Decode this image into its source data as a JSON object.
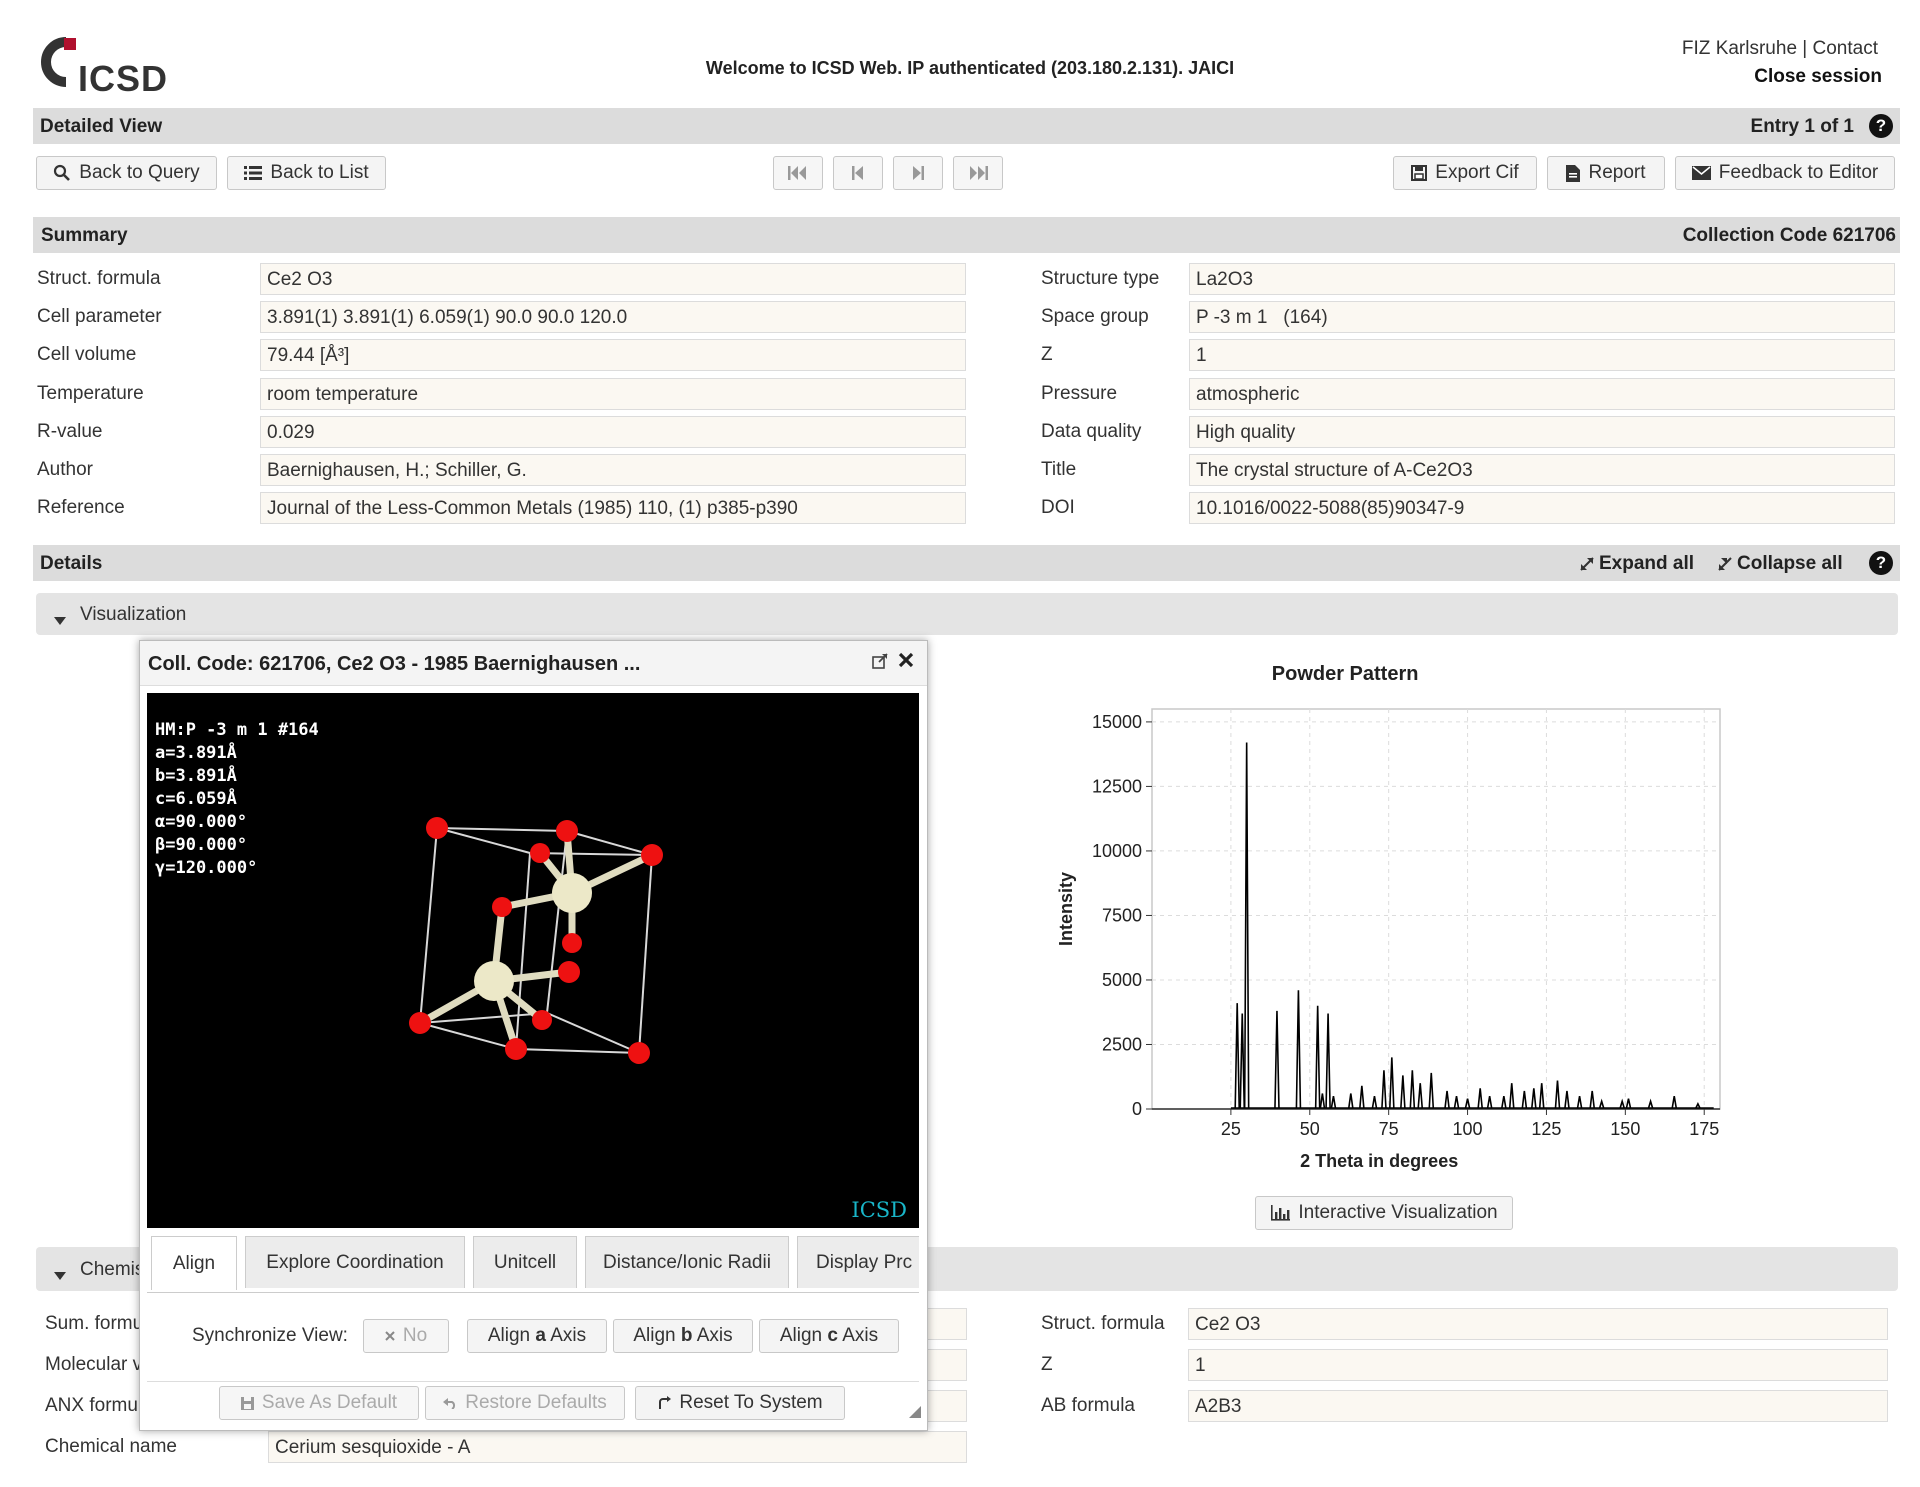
{
  "header": {
    "logo_text": "ICSD",
    "welcome": "Welcome to ICSD Web. IP authenticated (203.180.2.131). JAICI",
    "link_fiz": "FIZ Karlsruhe",
    "link_sep": "|",
    "link_contact": "Contact",
    "close_session": "Close session"
  },
  "detailed_view": {
    "title": "Detailed View",
    "entry": "Entry 1 of 1",
    "help": "?"
  },
  "toolbar": {
    "back_to_query": "Back to Query",
    "back_to_list": "Back to List",
    "nav_first": "⏮",
    "nav_prev": "⏴",
    "nav_next": "⏵",
    "nav_last": "⏭",
    "export_cif": "Export Cif",
    "report": "Report",
    "feedback": "Feedback to Editor"
  },
  "summary": {
    "title": "Summary",
    "collection_code": "Collection Code 621706",
    "left": [
      {
        "label": "Struct. formula",
        "value": "Ce2 O3"
      },
      {
        "label": "Cell parameter",
        "value": "3.891(1) 3.891(1) 6.059(1) 90.0 90.0 120.0"
      },
      {
        "label": "Cell volume",
        "value": "79.44 [Å³]"
      },
      {
        "label": "Temperature",
        "value": "room temperature"
      },
      {
        "label": "R-value",
        "value": "0.029"
      },
      {
        "label": "Author",
        "value": "Baernighausen, H.; Schiller, G."
      },
      {
        "label": "Reference",
        "value": "Journal of the Less-Common Metals (1985) 110, (1) p385-p390"
      }
    ],
    "right": [
      {
        "label": "Structure type",
        "value": "La2O3"
      },
      {
        "label": "Space group",
        "value": "P -3 m 1   (164)"
      },
      {
        "label": "Z",
        "value": "1"
      },
      {
        "label": "Pressure",
        "value": "atmospheric"
      },
      {
        "label": "Data quality",
        "value": "High quality"
      },
      {
        "label": "Title",
        "value": "The crystal structure of A-Ce2O3"
      },
      {
        "label": "DOI",
        "value": "10.1016/0022-5088(85)90347-9"
      }
    ]
  },
  "details": {
    "title": "Details",
    "expand_all": "Expand all",
    "collapse_all": "Collapse all",
    "help": "?"
  },
  "visualization": {
    "section_label": "Visualization",
    "interactive_button": "Interactive Visualization"
  },
  "chemistry": {
    "section_label": "Chemis",
    "left_labels": [
      "Sum. formu",
      "Molecular v",
      "ANX formu",
      "Chemical name"
    ],
    "chemical_name_value": "Cerium sesquioxide - A",
    "right": [
      {
        "label": "Struct. formula",
        "value": "Ce2 O3"
      },
      {
        "label": "Z",
        "value": "1"
      },
      {
        "label": "AB formula",
        "value": "A2B3"
      }
    ]
  },
  "dialog": {
    "title": "Coll. Code: 621706, Ce2 O3 - 1985 Baernighausen ...",
    "viewer_lines": [
      "HM:P -3 m 1 #164",
      "a=3.891Å",
      "b=3.891Å",
      "c=6.059Å",
      "α=90.000°",
      "β=90.000°",
      "γ=120.000°"
    ],
    "watermark": "ICSD",
    "tabs": [
      "Align",
      "Explore Coordination",
      "Unitcell",
      "Distance/Ionic Radii",
      "Display Prc"
    ],
    "sync_label": "Synchronize View:",
    "sync_value": "No",
    "align_a_pre": "Align ",
    "align_a_bold": "a",
    "align_a_post": " Axis",
    "align_b_pre": "Align ",
    "align_b_bold": "b",
    "align_b_post": " Axis",
    "align_c_pre": "Align ",
    "align_c_bold": "c",
    "align_c_post": " Axis",
    "save_default": "Save As Default",
    "restore_defaults": "Restore Defaults",
    "reset_system": "Reset To System"
  },
  "chart_data": {
    "type": "line",
    "title": "Powder Pattern",
    "xlabel": "2 Theta in degrees",
    "ylabel": "Intensity",
    "xlim": [
      0,
      180
    ],
    "ylim": [
      0,
      15500
    ],
    "xticks": [
      25,
      50,
      75,
      100,
      125,
      150,
      175
    ],
    "yticks": [
      0,
      2500,
      5000,
      7500,
      10000,
      12500,
      15000
    ],
    "grid": true,
    "peaks": [
      {
        "x": 27.0,
        "y": 4100
      },
      {
        "x": 28.6,
        "y": 3700
      },
      {
        "x": 30.0,
        "y": 14200
      },
      {
        "x": 39.6,
        "y": 3800
      },
      {
        "x": 46.4,
        "y": 4600
      },
      {
        "x": 52.5,
        "y": 4000
      },
      {
        "x": 55.8,
        "y": 3700
      },
      {
        "x": 54.0,
        "y": 600
      },
      {
        "x": 57.5,
        "y": 500
      },
      {
        "x": 63.0,
        "y": 600
      },
      {
        "x": 66.5,
        "y": 900
      },
      {
        "x": 70.5,
        "y": 500
      },
      {
        "x": 73.5,
        "y": 1500
      },
      {
        "x": 76.0,
        "y": 2000
      },
      {
        "x": 79.5,
        "y": 1300
      },
      {
        "x": 82.5,
        "y": 1500
      },
      {
        "x": 85.0,
        "y": 1000
      },
      {
        "x": 88.5,
        "y": 1400
      },
      {
        "x": 93.5,
        "y": 700
      },
      {
        "x": 96.5,
        "y": 500
      },
      {
        "x": 100.0,
        "y": 400
      },
      {
        "x": 104.0,
        "y": 800
      },
      {
        "x": 107.0,
        "y": 500
      },
      {
        "x": 111.5,
        "y": 500
      },
      {
        "x": 114.0,
        "y": 1000
      },
      {
        "x": 118.0,
        "y": 700
      },
      {
        "x": 121.0,
        "y": 800
      },
      {
        "x": 123.5,
        "y": 1000
      },
      {
        "x": 128.5,
        "y": 1100
      },
      {
        "x": 131.5,
        "y": 700
      },
      {
        "x": 135.5,
        "y": 500
      },
      {
        "x": 139.5,
        "y": 700
      },
      {
        "x": 142.5,
        "y": 300
      },
      {
        "x": 149.0,
        "y": 300
      },
      {
        "x": 151.0,
        "y": 400
      },
      {
        "x": 158.0,
        "y": 300
      },
      {
        "x": 165.5,
        "y": 500
      },
      {
        "x": 173.0,
        "y": 200
      }
    ]
  }
}
